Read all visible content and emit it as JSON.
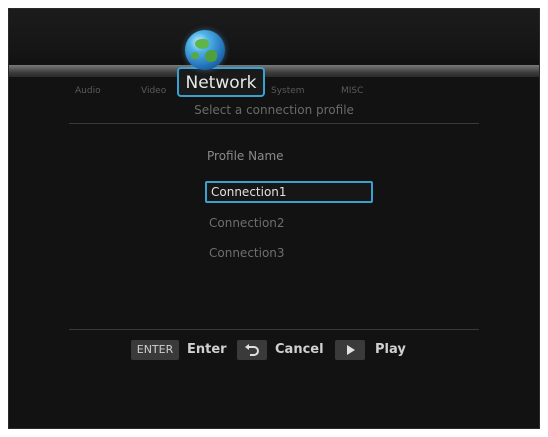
{
  "menu": {
    "tabs": [
      {
        "label": "Audio"
      },
      {
        "label": "Video"
      },
      {
        "label": "Network"
      },
      {
        "label": "System"
      },
      {
        "label": "MISC"
      }
    ],
    "active_tab": "Network",
    "active_icon": "globe-icon"
  },
  "page": {
    "subtitle": "Select a connection profile"
  },
  "profiles": {
    "header": "Profile Name",
    "items": [
      "Connection1",
      "Connection2",
      "Connection3"
    ],
    "selected": "Connection1"
  },
  "footer": {
    "enter_key": "ENTER",
    "enter_label": "Enter",
    "cancel_icon": "return-arrow-icon",
    "cancel_label": "Cancel",
    "play_icon": "play-icon",
    "play_label": "Play"
  },
  "colors": {
    "highlight": "#3aa0d0",
    "background": "#121212"
  }
}
